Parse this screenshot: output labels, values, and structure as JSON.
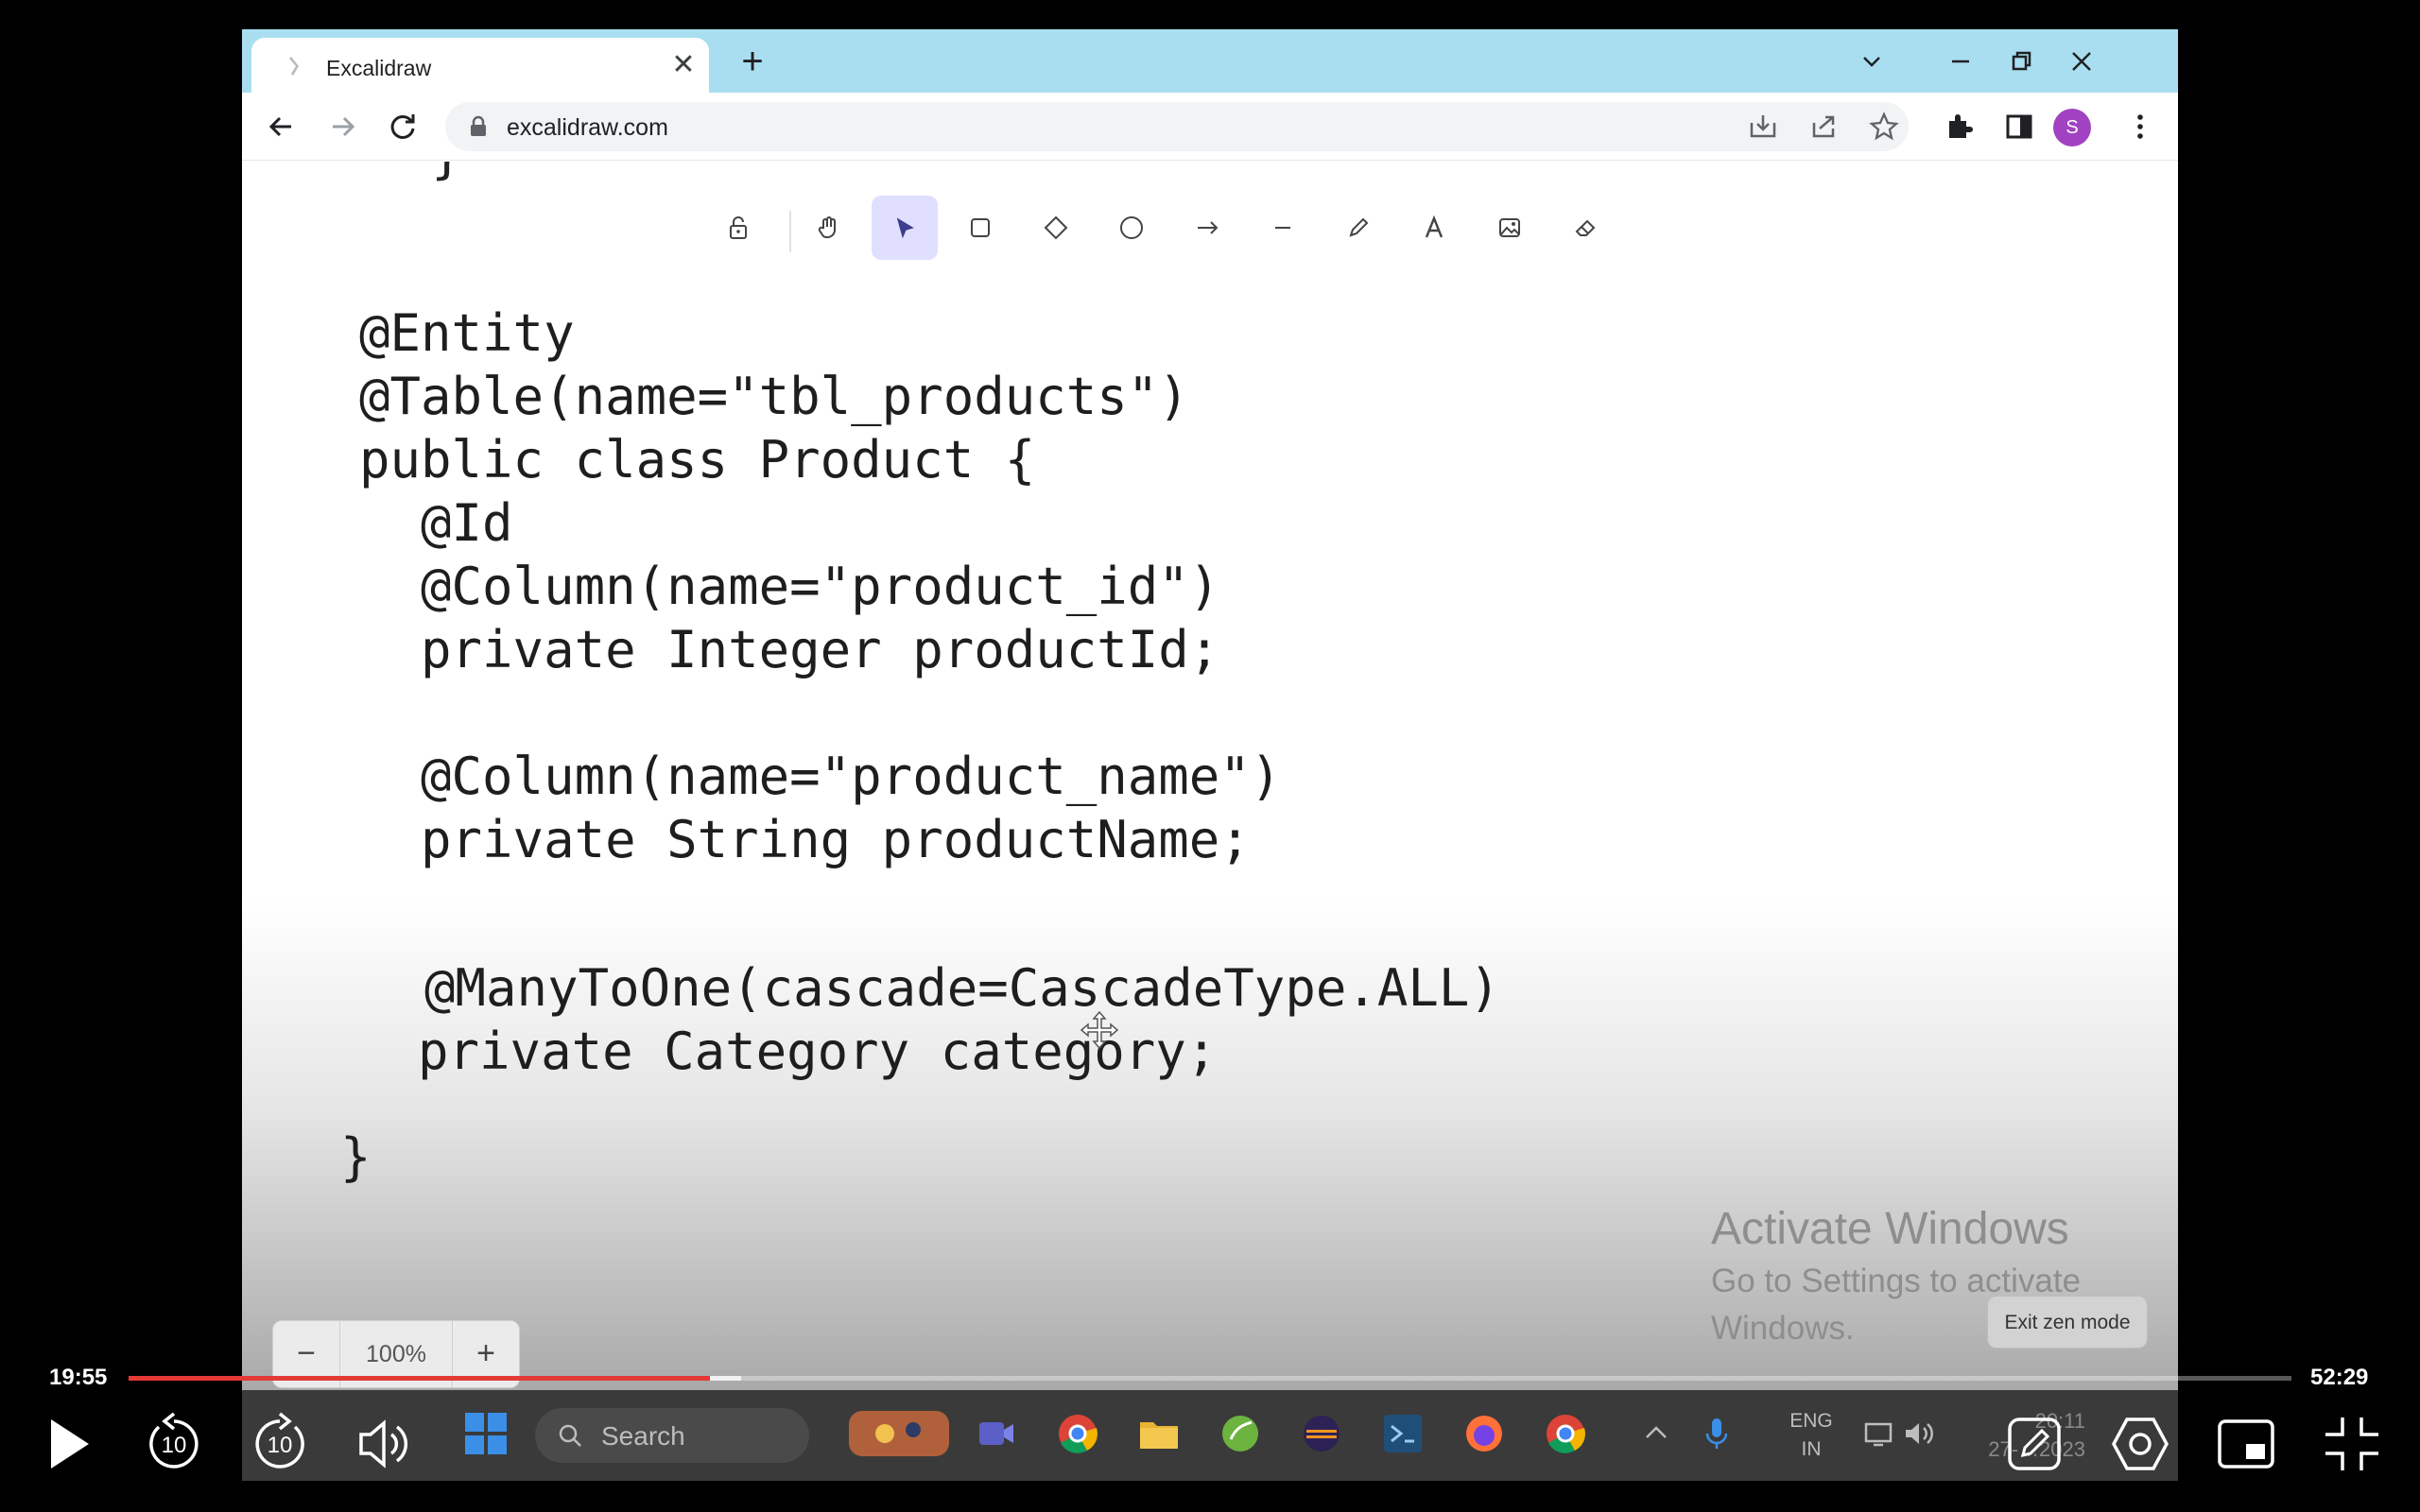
{
  "browser": {
    "tab_title": "Excalidraw",
    "new_tab_label": "+",
    "close_tab_label": "✕",
    "url": "excalidraw.com",
    "avatar_letter": "S"
  },
  "excalidraw": {
    "stray_brace": "}",
    "toolbar": [
      {
        "name": "lock",
        "active": false
      },
      {
        "name": "hand",
        "active": false
      },
      {
        "name": "selection",
        "active": true
      },
      {
        "name": "rectangle",
        "active": false
      },
      {
        "name": "diamond",
        "active": false
      },
      {
        "name": "ellipse",
        "active": false
      },
      {
        "name": "arrow",
        "active": false
      },
      {
        "name": "line",
        "active": false
      },
      {
        "name": "draw",
        "active": false
      },
      {
        "name": "text",
        "active": false
      },
      {
        "name": "image",
        "active": false
      },
      {
        "name": "eraser",
        "active": false
      }
    ],
    "code_lines": [
      "@Entity",
      "@Table(name=\"tbl_products\")",
      "public class Product {",
      "  @Id",
      "  @Column(name=\"product_id\")",
      "  private Integer productId;",
      "  @Column(name=\"product_name\")",
      "  private String productName;",
      "  @ManyToOne(cascade=CascadeType.ALL)",
      "  private Category category;",
      "}"
    ],
    "zoom": {
      "minus": "−",
      "value": "100%",
      "plus": "+"
    },
    "exit_zen_label": "Exit zen mode"
  },
  "watermark": {
    "title": "Activate Windows",
    "subtitle": "Go to Settings to activate Windows."
  },
  "taskbar": {
    "search_placeholder": "Search",
    "lang_line1": "ENG",
    "lang_line2": "IN",
    "clock_time": "20:11",
    "clock_date": "27-…2023"
  },
  "player": {
    "current_time": "19:55",
    "total_time": "52:29",
    "progress_fraction": 0.2686,
    "buffered_fraction": 0.2832,
    "skip_back_seconds": "10",
    "skip_forward_seconds": "10",
    "accent_color": "#e53935"
  }
}
